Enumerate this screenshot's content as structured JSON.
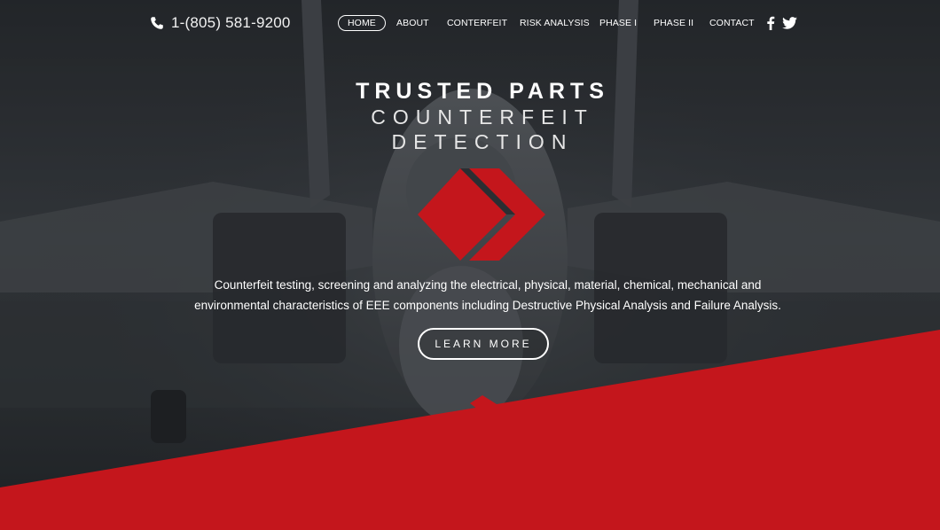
{
  "header": {
    "phone": "1-(805) 581-9200",
    "phone_icon": "phone-icon",
    "nav": [
      {
        "label": "HOME",
        "active": true
      },
      {
        "label": "ABOUT"
      },
      {
        "label": "CONTERFEIT"
      },
      {
        "label": "RISK ANALYSIS"
      },
      {
        "label": "PHASE I"
      },
      {
        "label": "PHASE II"
      },
      {
        "label": "CONTACT"
      }
    ],
    "social": [
      "facebook-icon",
      "twitter-icon"
    ]
  },
  "hero": {
    "title_line1": "TRUSTED PARTS",
    "title_line2": "COUNTERFEIT",
    "title_line3": "DETECTION",
    "description_line1": "Counterfeit testing, screening and analyzing the electrical, physical, material, chemical, mechanical and",
    "description_line2": "environmental characteristics of EEE components including Destructive Physical Analysis and Failure Analysis.",
    "cta_label": "LEARN MORE"
  },
  "colors": {
    "accent_red": "#c4161c",
    "overlay": "#2a2d31"
  }
}
